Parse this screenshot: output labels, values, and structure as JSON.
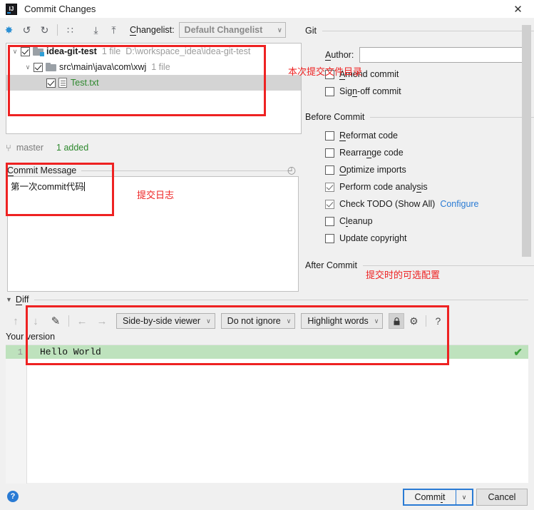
{
  "window": {
    "title": "Commit Changes",
    "logo_text": "IJ",
    "close_label": "✕"
  },
  "toolbar": {
    "icons": [
      {
        "name": "collapse-diff-icon",
        "glyph": "✸"
      },
      {
        "name": "rollback-icon",
        "glyph": "↺"
      },
      {
        "name": "refresh-icon",
        "glyph": "↻"
      },
      {
        "name": "group-by-icon",
        "glyph": "∷"
      },
      {
        "name": "expand-all-icon",
        "glyph": "⤓"
      },
      {
        "name": "collapse-all-icon",
        "glyph": "⤒"
      }
    ],
    "changelist_label": "Changelist:",
    "changelist_value": "Default Changelist",
    "combo_arrow": "∨"
  },
  "tree": {
    "rows": [
      {
        "twisty": "∨",
        "checked": true,
        "icon": "vcs-root-folder-icon",
        "name": "idea-git-test",
        "bold": true,
        "meta1": "1 file",
        "meta2": "D:\\workspace_idea\\idea-git-test",
        "indent": 0,
        "selected": false
      },
      {
        "twisty": "∨",
        "checked": true,
        "icon": "folder-icon",
        "name": "src\\main\\java\\com\\xwj",
        "bold": false,
        "meta1": "1 file",
        "meta2": "",
        "indent": 1,
        "selected": false
      },
      {
        "twisty": "",
        "checked": true,
        "icon": "text-file-icon",
        "name": "Test.txt",
        "bold": false,
        "green": true,
        "meta1": "",
        "meta2": "",
        "indent": 2,
        "selected": true
      }
    ]
  },
  "status": {
    "branch_icon": "⑂",
    "branch": "master",
    "added": "1 added"
  },
  "commit_message": {
    "legend": "Commit Message",
    "legend_accel": "C",
    "value": "第一次commit代码",
    "history_icon": "◴"
  },
  "git_group": {
    "legend": "Git",
    "author_label": "Author:",
    "author_accel": "A",
    "author_value": "",
    "checkboxes": [
      {
        "name": "amend-commit",
        "label": "Amend commit",
        "accel": "A",
        "checked": false
      },
      {
        "name": "sign-off-commit",
        "label": "Sign-off commit",
        "accel": "n",
        "checked": false
      }
    ]
  },
  "before_commit": {
    "legend": "Before Commit",
    "checkboxes": [
      {
        "name": "reformat-code",
        "label": "Reformat code",
        "checked": false
      },
      {
        "name": "rearrange-code",
        "label": "Rearrange code",
        "checked": false
      },
      {
        "name": "optimize-imports",
        "label": "Optimize imports",
        "checked": false
      },
      {
        "name": "perform-code-analysis",
        "label": "Perform code analysis",
        "checked": true
      },
      {
        "name": "check-todo",
        "label": "Check TODO (Show All)",
        "checked": true,
        "link": "Configure"
      },
      {
        "name": "cleanup",
        "label": "Cleanup",
        "checked": false
      },
      {
        "name": "update-copyright",
        "label": "Update copyright",
        "checked": false
      }
    ]
  },
  "after_commit": {
    "legend": "After Commit"
  },
  "diff": {
    "legend": "Diff",
    "legend_triangle": "▼",
    "toolbar": {
      "prev_diff": "↑",
      "next_diff": "↓",
      "edit": "✎",
      "apply_left": "←",
      "apply_right": "→",
      "viewer_mode": "Side-by-side viewer",
      "whitespace": "Do not ignore",
      "highlight": "Highlight words",
      "lock_icon": "🔒",
      "gear_icon": "⚙",
      "help_icon": "?",
      "arrow": "∨"
    },
    "your_version_label": "Your version",
    "lines": [
      {
        "num": "1",
        "text": "Hello World",
        "status": "added"
      }
    ],
    "marker": "✔"
  },
  "bottom": {
    "help": "?",
    "commit_label": "Commit",
    "commit_accel": "i",
    "commit_arrow": "∨",
    "cancel_label": "Cancel"
  },
  "annotations": {
    "tree_note": "本次提交文件目录",
    "message_note": "提交日志",
    "after_note": "提交时的可选配置",
    "color": "#ee2222"
  }
}
